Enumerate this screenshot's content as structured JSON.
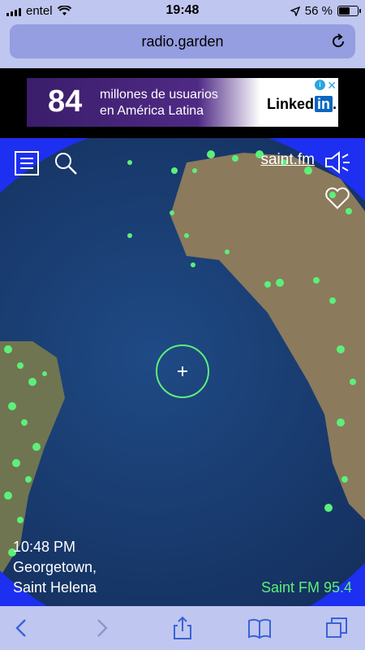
{
  "status": {
    "carrier": "entel",
    "time": "19:48",
    "battery_text": "56 %",
    "battery_level": 0.56
  },
  "browser": {
    "url": "radio.garden"
  },
  "ad": {
    "number": "84",
    "line1": "millones de usuarios",
    "line2": "en América Latina",
    "brand_text": "Linked",
    "brand_badge": "in",
    "brand_suffix": "."
  },
  "map": {
    "site_link": "saint.fm",
    "local_time": "10:48 PM",
    "place_line1": "Georgetown,",
    "place_line2": "Saint Helena",
    "station_name": "Saint FM 95.4"
  },
  "colors": {
    "background_blue": "#1d2ff0",
    "station_green": "#5cf07a",
    "ocean": "#1b3f76",
    "land": "#8b7a5c"
  },
  "icons": {
    "menu": "menu-icon",
    "search": "search-icon",
    "speaker": "speaker-icon",
    "favorite": "heart-icon",
    "back": "back-arrow-icon",
    "forward": "forward-arrow-icon",
    "share": "share-icon",
    "bookmarks": "book-icon",
    "tabs": "tabs-icon"
  }
}
